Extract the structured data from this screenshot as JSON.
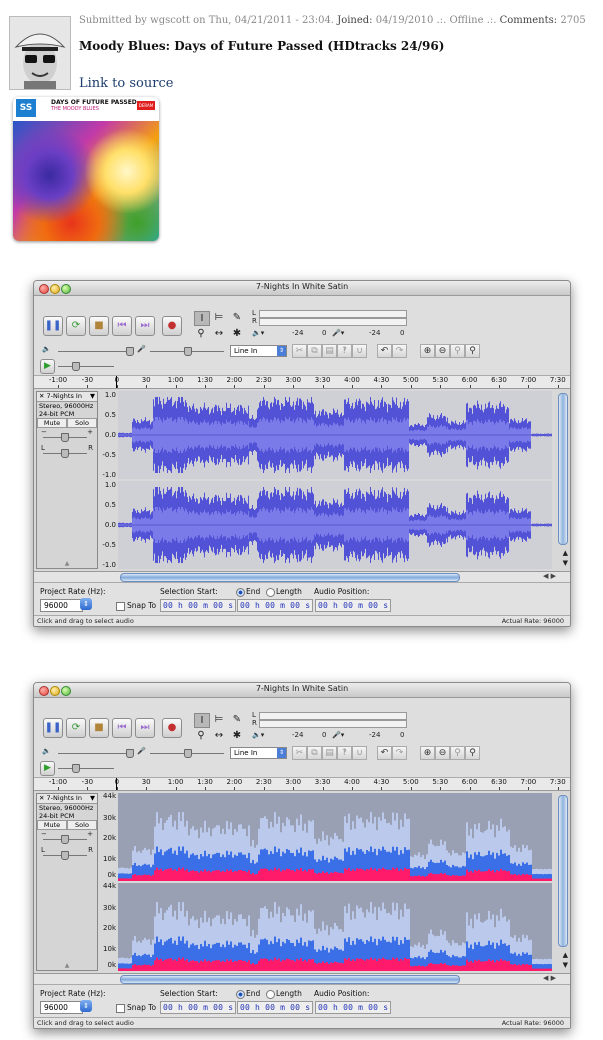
{
  "post": {
    "submitted_by": "Submitted by wgscott on Thu, 04/21/2011 - 23:04.",
    "joined_label": "Joined:",
    "joined_date": "04/19/2010",
    "status": ".:. Offline .:.",
    "comments_label": "Comments:",
    "comments_count": "2705",
    "title": "Moody Blues: Days of Future Passed (HDtracks 24/96)",
    "link_text": "Link to source"
  },
  "cover": {
    "badge": "SS",
    "title": "DAYS OF FUTURE PASSED",
    "artist": "THE MOODY BLUES",
    "label": "DERAM"
  },
  "windows": [
    {
      "title": "7-Nights In White Satin",
      "view": "waveform",
      "track": {
        "name": "7-Nights In",
        "info1": "Stereo, 96000Hz",
        "info2": "24-bit PCM",
        "mute": "Mute",
        "solo": "Solo"
      },
      "vscale": [
        "1.0",
        "0.5",
        "0.0",
        "-0.5",
        "-1.0"
      ],
      "colors": {
        "wave": "#5252d6",
        "wave_rms": "#7a7ae8",
        "background": "#cfcfd6"
      }
    },
    {
      "title": "7-Nights In White Satin",
      "view": "spectrogram",
      "track": {
        "name": "7-Nights In",
        "info1": "Stereo, 96000Hz",
        "info2": "24-bit PCM",
        "mute": "Mute",
        "solo": "Solo"
      },
      "vscale": [
        "44k",
        "30k",
        "20k",
        "10k",
        "0k"
      ],
      "colors": {
        "low": "#ff1a6a",
        "mid": "#3b6fe8",
        "high": "#bfd0f6"
      }
    }
  ],
  "toolbar": {
    "meter_labels": [
      "-24",
      "0",
      "-24",
      "0"
    ],
    "input_source": "Line In",
    "lr": [
      "L",
      "R"
    ]
  },
  "ruler": [
    "-1:00",
    "-30",
    "0",
    "30",
    "1:00",
    "1:30",
    "2:00",
    "2:30",
    "3:00",
    "3:30",
    "4:00",
    "4:30",
    "5:00",
    "5:30",
    "6:00",
    "6:30",
    "7:00",
    "7:30"
  ],
  "selection": {
    "project_rate_label": "Project Rate (Hz):",
    "project_rate": "96000",
    "selection_start_label": "Selection Start:",
    "end_label": "End",
    "length_label": "Length",
    "snap_label": "Snap To",
    "audio_position_label": "Audio Position:",
    "time1": "00 h 00 m 00 s",
    "time2": "00 h 00 m 00 s",
    "time3": "00 h 00 m 00 s"
  },
  "status": {
    "hint": "Click and drag to select audio",
    "actual_rate": "Actual Rate: 96000"
  }
}
